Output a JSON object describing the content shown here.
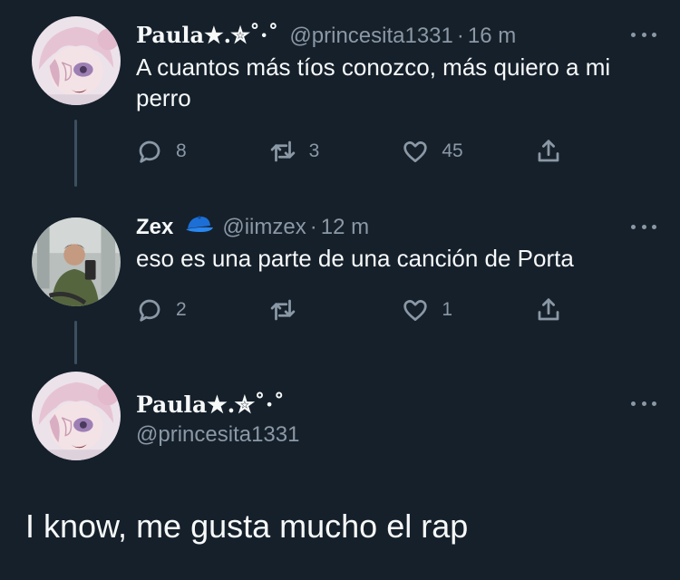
{
  "tweets": [
    {
      "name": "Paula★.✮˚·˚",
      "handle": "@princesita1331",
      "separator": "·",
      "time": "16 m",
      "text": "A cuantos más tíos conozco, más quiero a mi perro",
      "replies": "8",
      "retweets": "3",
      "likes": "45"
    },
    {
      "name": "Zex",
      "handle": "@iimzex",
      "separator": "·",
      "time": "12 m",
      "text": "eso es una parte de una canción de Porta",
      "replies": "2",
      "retweets": "",
      "likes": "1"
    }
  ],
  "reply": {
    "name": "Paula★.✮˚·˚",
    "handle": "@princesita1331",
    "text": "I know, me gusta mucho el rap"
  },
  "icons": {
    "reply": "reply-icon",
    "retweet": "retweet-icon",
    "like": "heart-icon",
    "share": "share-icon",
    "more": "more-icon",
    "cap": "blue-cap-emoji"
  },
  "colors": {
    "background": "#15202b",
    "text": "#f7f9f9",
    "muted": "#8b98a5",
    "line": "#3d4f5f",
    "cap": "#1d6fd6"
  }
}
